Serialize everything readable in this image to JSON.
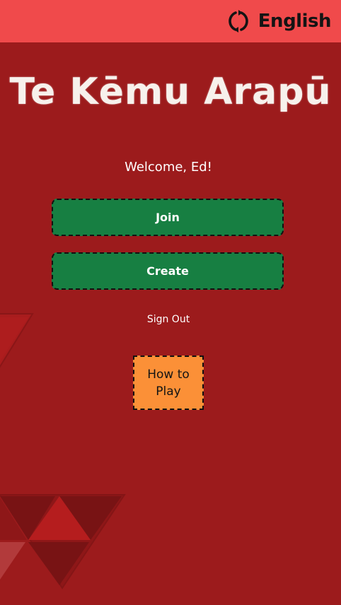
{
  "header": {
    "language_label": "English",
    "language_icon": "refresh-icon"
  },
  "app": {
    "title": "Te Kēmu Arapū"
  },
  "main": {
    "welcome_text": "Welcome, Ed!",
    "join_label": "Join",
    "create_label": "Create",
    "sign_out_label": "Sign Out",
    "how_to_play_label": "How to Play"
  },
  "colors": {
    "background": "#9c1b1c",
    "topbar": "#f04a4b",
    "primary_button": "#177f42",
    "how_to_play_button": "#fb9037",
    "title_text": "#f7f1ec"
  }
}
